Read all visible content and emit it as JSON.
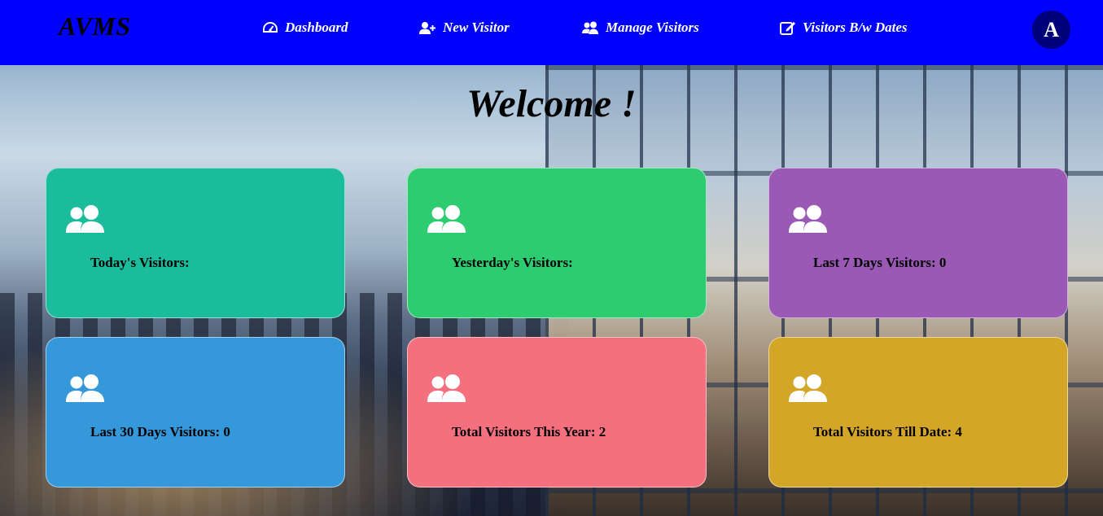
{
  "navbar": {
    "brand": "AVMS",
    "items": [
      {
        "label": "Dashboard",
        "icon": "gauge-icon"
      },
      {
        "label": "New Visitor",
        "icon": "user-plus-icon"
      },
      {
        "label": "Manage Visitors",
        "icon": "users-icon"
      },
      {
        "label": "Visitors B/w Dates",
        "icon": "edit-icon"
      }
    ],
    "avatar_initial": "A",
    "background_color": "#0000ff"
  },
  "main": {
    "heading": "Welcome !"
  },
  "cards": [
    {
      "label": "Today's Visitors:",
      "color": "#1abc9c",
      "icon": "users-icon"
    },
    {
      "label": "Yesterday's Visitors:",
      "color": "#2ecc71",
      "icon": "users-icon"
    },
    {
      "label": "Last 7 Days Visitors: 0",
      "color": "#9b59b6",
      "icon": "users-icon"
    },
    {
      "label": "Last 30 Days Visitors: 0",
      "color": "#3498db",
      "icon": "users-icon"
    },
    {
      "label": "Total Visitors This Year: 2",
      "color": "#f5707f",
      "icon": "users-icon"
    },
    {
      "label": "Total Visitors Till Date: 4",
      "color": "#d4a627",
      "icon": "users-icon"
    }
  ]
}
